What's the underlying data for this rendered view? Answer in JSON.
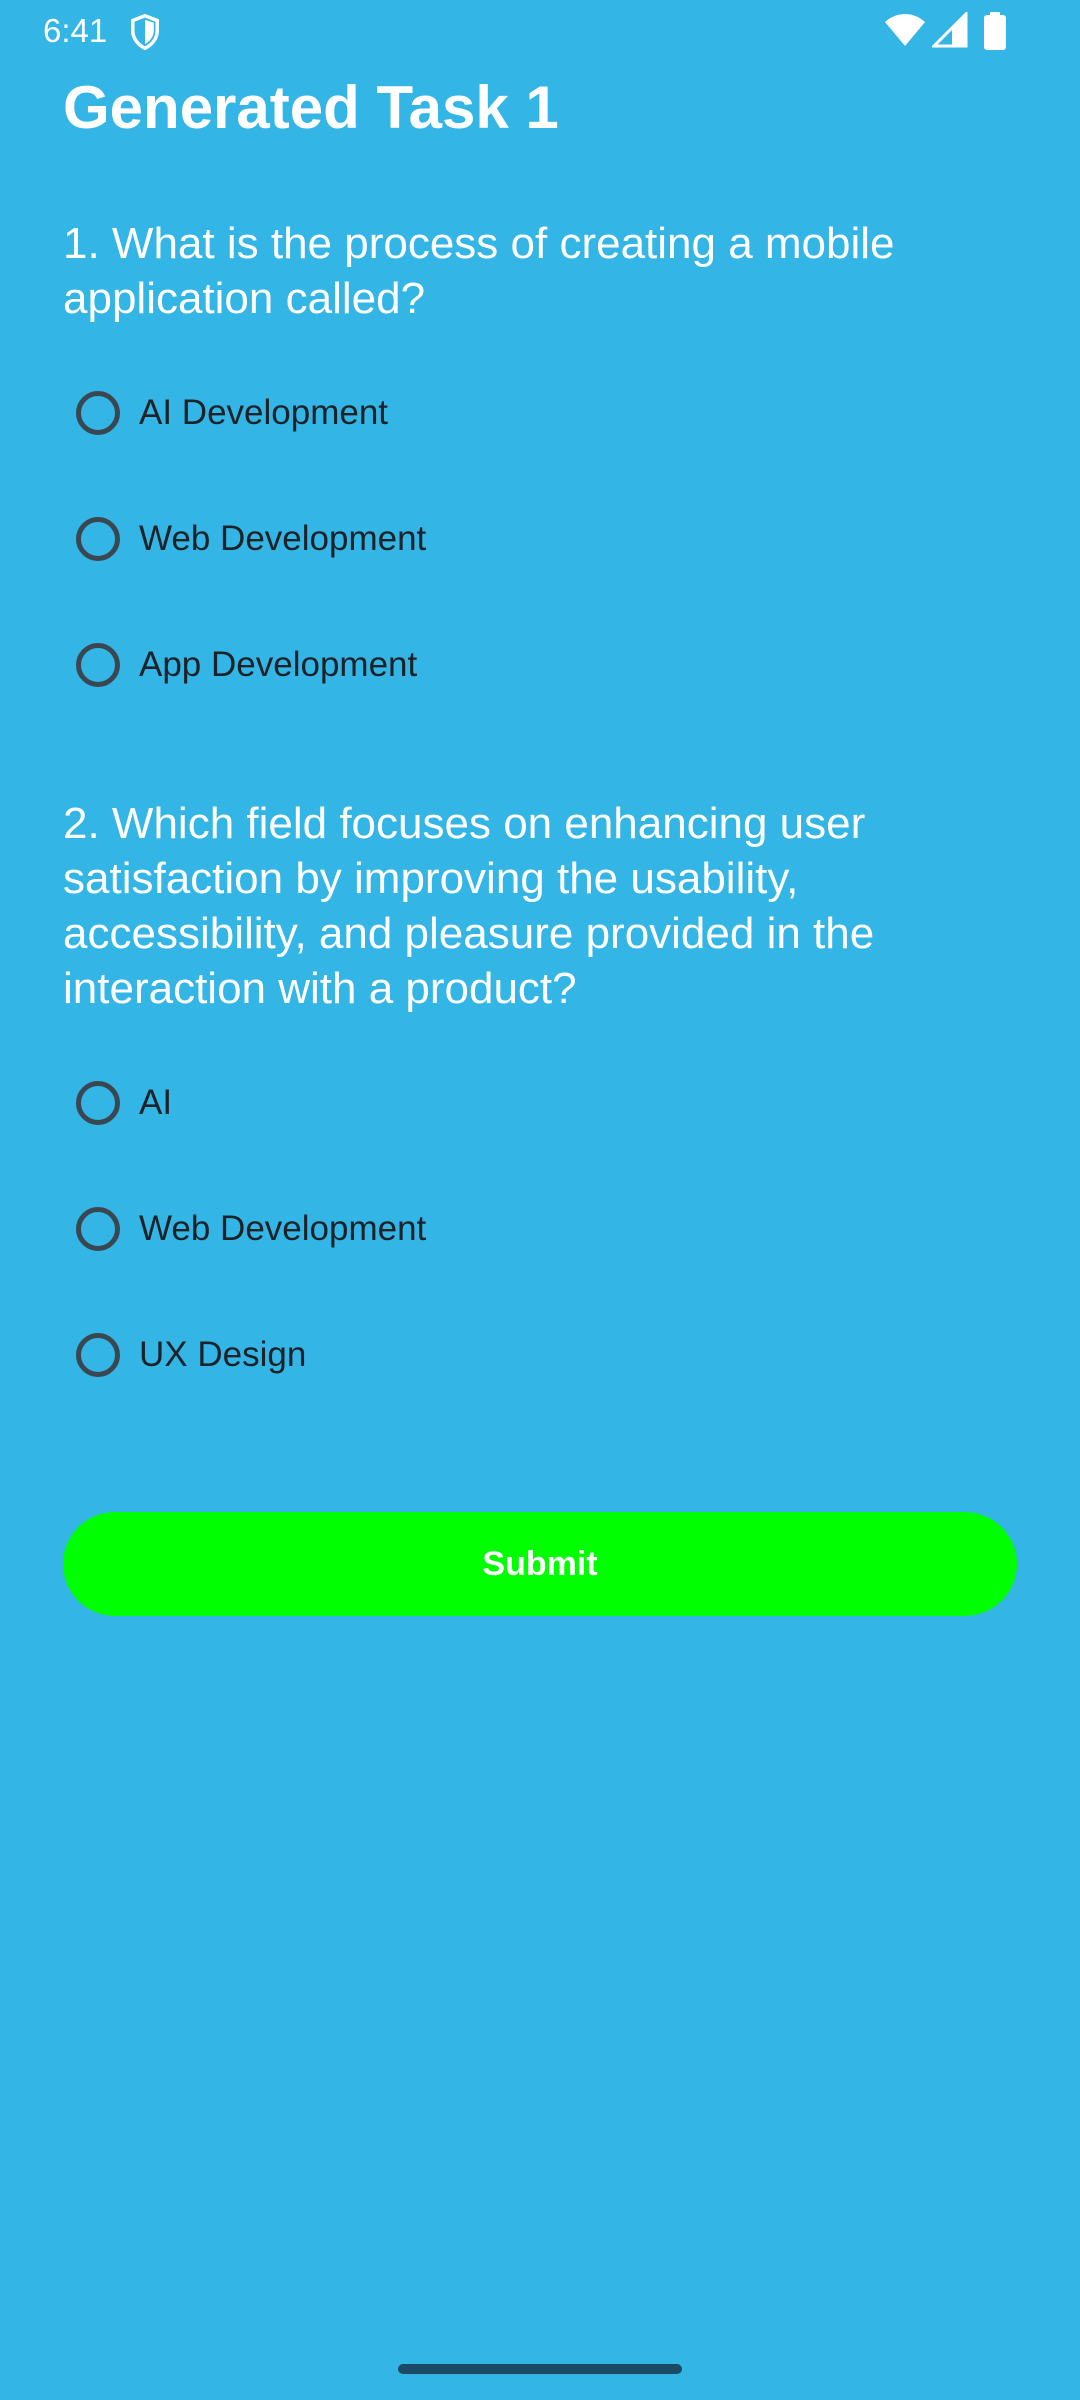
{
  "status_bar": {
    "time": "6:41",
    "icons": [
      "shield-icon",
      "wifi-icon",
      "signal-icon",
      "battery-icon"
    ]
  },
  "title": "Generated Task 1",
  "questions": [
    {
      "text": "1. What is the process of creating a mobile application called?",
      "options": [
        "AI Development",
        "Web Development",
        "App Development"
      ]
    },
    {
      "text": "2. Which field focuses on enhancing user satisfaction by improving the usability, accessibility, and pleasure provided in the interaction with a product?",
      "options": [
        "AI",
        "Web Development",
        "UX Design"
      ]
    }
  ],
  "submit_label": "Submit",
  "colors": {
    "background": "#33B5E5",
    "submit_button": "#00FF00",
    "text": "#FFFFFF"
  }
}
